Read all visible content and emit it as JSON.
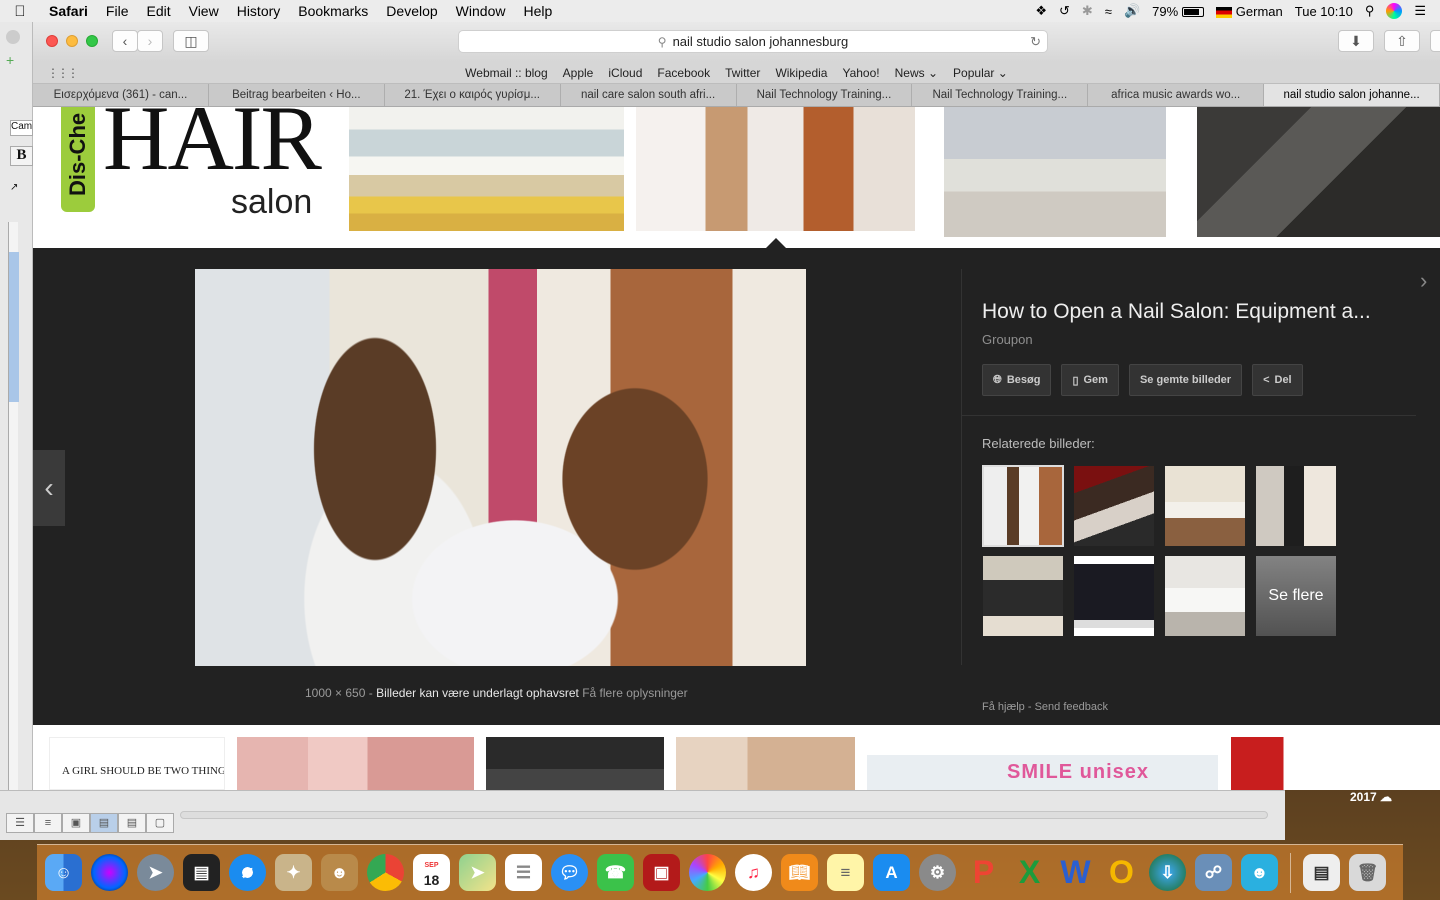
{
  "menubar": {
    "apple_icon": "apple-icon",
    "app_name": "Safari",
    "menus": [
      "File",
      "Edit",
      "View",
      "History",
      "Bookmarks",
      "Develop",
      "Window",
      "Help"
    ],
    "battery_percent": "79%",
    "input_source": "German",
    "clock": "Tue 10:10"
  },
  "leftstrip": {
    "field_text": "Cam",
    "bold_button": "B"
  },
  "toolbar": {
    "address": "nail studio salon johannesburg"
  },
  "favorites": [
    "Webmail :: blog",
    "Apple",
    "iCloud",
    "Facebook",
    "Twitter",
    "Wikipedia",
    "Yahoo!",
    "News",
    "Popular"
  ],
  "tabs": [
    "Εισερχόμενα (361) - can...",
    "Beitrag bearbeiten ‹ Ho...",
    "21. Έχει ο καιρός γυρίσμ...",
    "nail care salon south afri...",
    "Nail Technology Training...",
    "Nail Technology Training...",
    "africa music awards wo...",
    "nail studio salon johanne..."
  ],
  "page": {
    "logo": {
      "side_text": "Dis-Che",
      "main_text": "HAIR",
      "sub_text": "salon"
    },
    "preview": {
      "dimensions": "1000 × 650",
      "separator": "-",
      "copyright": "Billeder kan være underlagt ophavsret",
      "more_info": "Få flere oplysninger"
    },
    "info": {
      "title": "How to Open a Nail Salon: Equipment a...",
      "source": "Groupon",
      "actions": [
        "Besøg",
        "Gem",
        "Se gemte billeder",
        "Del"
      ],
      "related_label": "Relaterede billeder:",
      "see_more": "Se flere",
      "help": "Få hjælp",
      "help_sep": "-",
      "feedback": "Send feedback"
    },
    "bottom_thumbs": {
      "t1_text": "A GIRL SHOULD BE TWO THINGS",
      "t5_text": "SMILE unisex"
    }
  },
  "desktop": {
    "year_label": "2017"
  },
  "dock": {
    "calendar_month": "SEP",
    "calendar_day": "18"
  }
}
